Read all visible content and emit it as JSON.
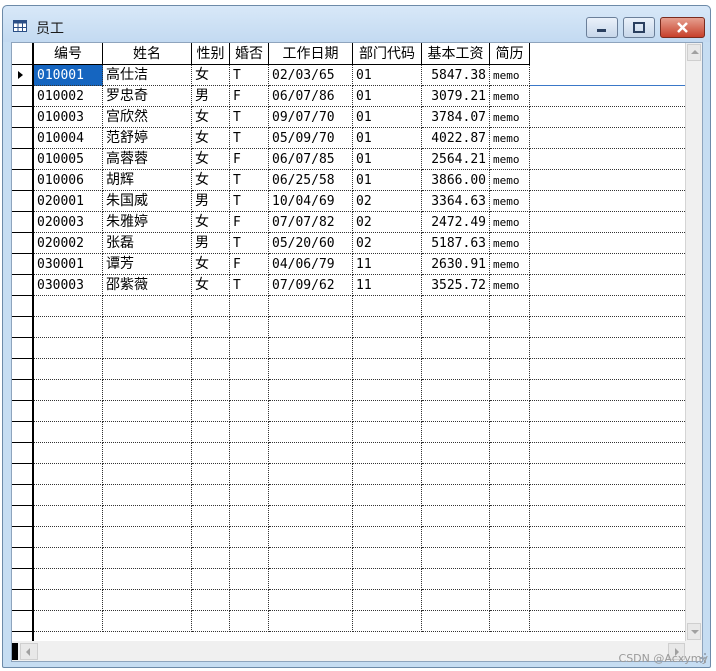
{
  "window": {
    "title": "员工",
    "icon": "table-icon",
    "controls": [
      "minimize-icon",
      "maximize-icon",
      "close-icon"
    ]
  },
  "grid": {
    "columns": [
      "编号",
      "姓名",
      "性别",
      "婚否",
      "工作日期",
      "部门代码",
      "基本工资",
      "简历"
    ],
    "rows": [
      [
        "010001",
        "高仕洁",
        "女",
        "T",
        "02/03/65",
        "01",
        "5847.38",
        "memo"
      ],
      [
        "010002",
        "罗忠奇",
        "男",
        "F",
        "06/07/86",
        "01",
        "3079.21",
        "memo"
      ],
      [
        "010003",
        " 宫欣然",
        "女",
        "T",
        "09/07/70",
        "01",
        "3784.07",
        "memo"
      ],
      [
        "010004",
        "范舒婷",
        "女",
        "T",
        "05/09/70",
        "01",
        "4022.87",
        "memo"
      ],
      [
        "010005",
        "高蓉蓉",
        "女",
        "F",
        "06/07/85",
        "01",
        "2564.21",
        "memo"
      ],
      [
        "010006",
        "胡辉",
        "女",
        "T",
        "06/25/58",
        "01",
        "3866.00",
        "memo"
      ],
      [
        "020001",
        "朱国威",
        "男",
        "T",
        "10/04/69",
        "02",
        "3364.63",
        "memo"
      ],
      [
        "020003",
        "朱雅婷",
        "女",
        "F",
        "07/07/82",
        "02",
        "2472.49",
        "memo"
      ],
      [
        "020002",
        "张磊",
        "男",
        "T",
        "05/20/60",
        "02",
        "5187.63",
        "memo"
      ],
      [
        "030001",
        "谭芳",
        "女",
        "F",
        "04/06/79",
        "11",
        "2630.91",
        "memo"
      ],
      [
        "030003",
        "邵紫薇",
        "女",
        "T",
        "07/09/62",
        "11",
        "3525.72",
        "memo"
      ]
    ],
    "selected_row": 0,
    "selected_col": 0,
    "selection_color": "#1565c0"
  },
  "watermark": "CSDN @Acxymy"
}
